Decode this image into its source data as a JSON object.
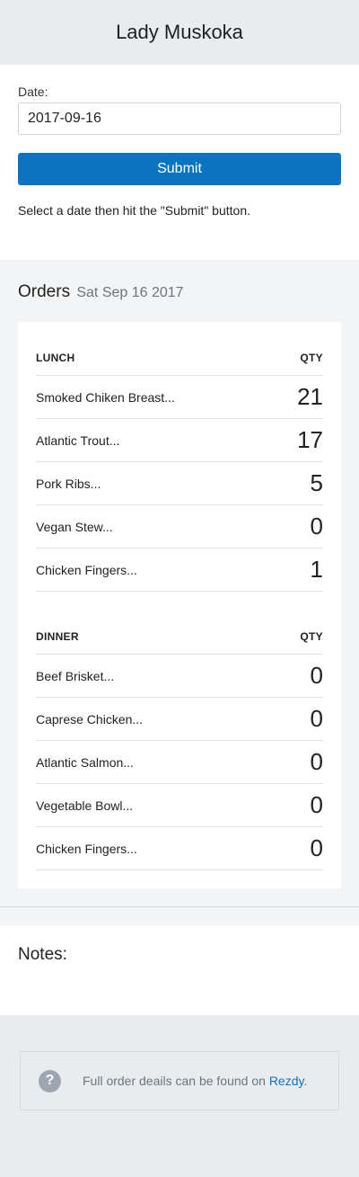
{
  "header": {
    "title": "Lady Muskoka"
  },
  "form": {
    "date_label": "Date:",
    "date_value": "2017-09-16",
    "submit_label": "Submit",
    "hint": "Select a date then hit the \"Submit\" button."
  },
  "orders": {
    "title": "Orders",
    "date": "Sat Sep 16 2017",
    "lunch": {
      "heading": "LUNCH",
      "qty_label": "QTY",
      "items": [
        {
          "name": "Smoked Chiken Breast...",
          "qty": "21"
        },
        {
          "name": "Atlantic Trout...",
          "qty": "17"
        },
        {
          "name": "Pork Ribs...",
          "qty": "5"
        },
        {
          "name": "Vegan Stew...",
          "qty": "0"
        },
        {
          "name": "Chicken Fingers...",
          "qty": "1"
        }
      ]
    },
    "dinner": {
      "heading": "DINNER",
      "qty_label": "QTY",
      "items": [
        {
          "name": "Beef Brisket...",
          "qty": "0"
        },
        {
          "name": "Caprese Chicken...",
          "qty": "0"
        },
        {
          "name": "Atlantic Salmon...",
          "qty": "0"
        },
        {
          "name": "Vegetable Bowl...",
          "qty": "0"
        },
        {
          "name": "Chicken Fingers...",
          "qty": "0"
        }
      ]
    }
  },
  "notes": {
    "title": "Notes:"
  },
  "footer": {
    "icon": "help-icon",
    "text": "Full order deails can be found on ",
    "link_text": "Rezdy",
    "suffix": "."
  }
}
